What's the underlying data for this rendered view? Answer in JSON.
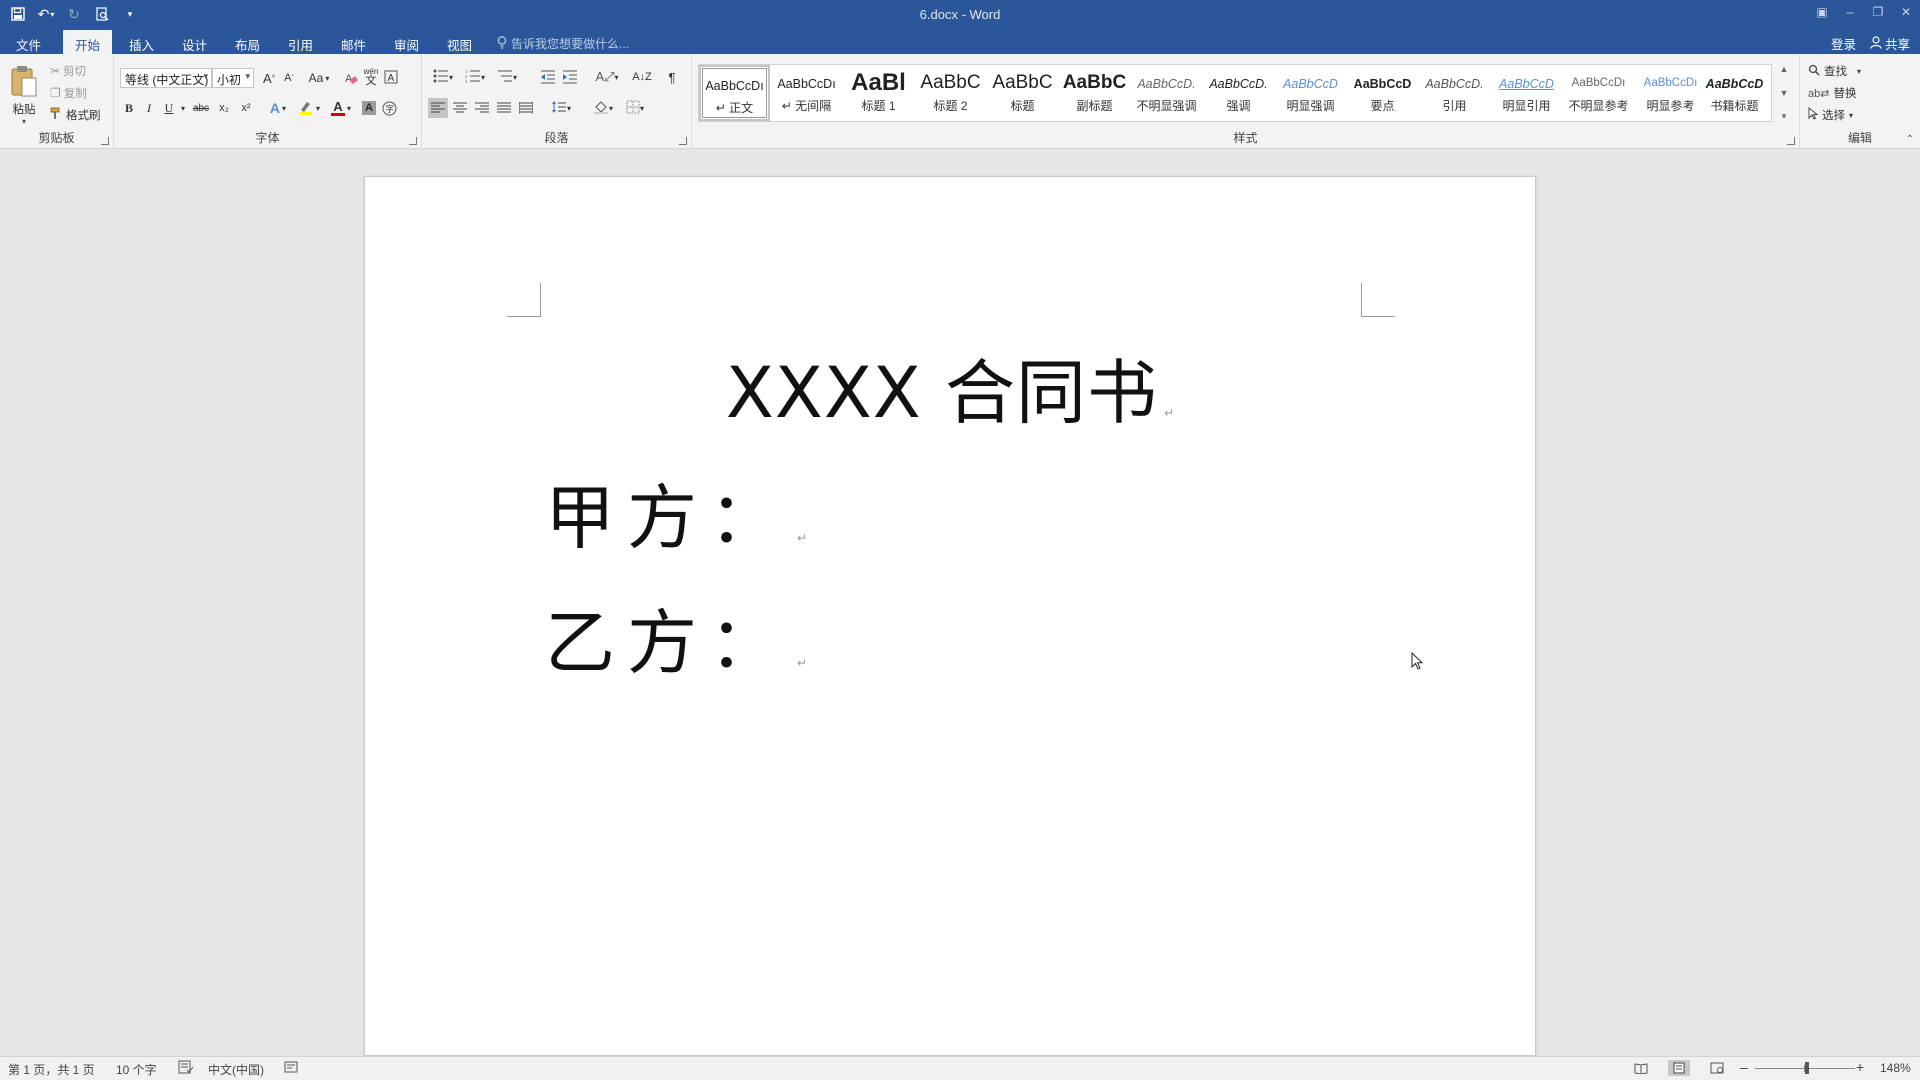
{
  "window": {
    "title": "6.docx - Word",
    "controls": [
      "▣",
      "–",
      "❐",
      "✕"
    ]
  },
  "quick_access": {
    "save_icon": "save-icon",
    "undo_icon": "undo-icon",
    "redo_icon": "redo-icon",
    "print_preview_icon": "print-preview-icon",
    "customize_icon": "customize-icon"
  },
  "tabs": [
    {
      "label": "文件"
    },
    {
      "label": "开始"
    },
    {
      "label": "插入"
    },
    {
      "label": "设计"
    },
    {
      "label": "布局"
    },
    {
      "label": "引用"
    },
    {
      "label": "邮件"
    },
    {
      "label": "审阅"
    },
    {
      "label": "视图"
    }
  ],
  "tell_me": {
    "placeholder": "告诉我您想要做什么..."
  },
  "account": {
    "signin": "登录",
    "share": "共享"
  },
  "clipboard": {
    "paste": "粘贴",
    "cut": "剪切",
    "copy": "复制",
    "format_painter": "格式刷",
    "group_label": "剪贴板"
  },
  "font": {
    "name": "等线 (中文正文)",
    "size": "小初",
    "group_label": "字体",
    "change_case": "Aa",
    "bold": "B",
    "italic": "I",
    "underline": "U",
    "strikethrough": "abc",
    "subscript": "x₂",
    "superscript": "x²",
    "phonetic": "wén"
  },
  "paragraph": {
    "group_label": "段落"
  },
  "styles": {
    "group_label": "样式",
    "items": [
      {
        "preview": "AaBbCcDı",
        "name": "↵ 正文"
      },
      {
        "preview": "AaBbCcDı",
        "name": "↵ 无间隔"
      },
      {
        "preview": "AaBl",
        "name": "标题 1"
      },
      {
        "preview": "AaBbC",
        "name": "标题 2"
      },
      {
        "preview": "AaBbC",
        "name": "标题"
      },
      {
        "preview": "AaBbC",
        "name": "副标题"
      },
      {
        "preview": "AaBbCcD.",
        "name": "不明显强调"
      },
      {
        "preview": "AaBbCcD.",
        "name": "强调"
      },
      {
        "preview": "AaBbCcD",
        "name": "明显强调"
      },
      {
        "preview": "AaBbCcD",
        "name": "要点"
      },
      {
        "preview": "AaBbCcD.",
        "name": "引用"
      },
      {
        "preview": "AaBbCcD",
        "name": "明显引用"
      },
      {
        "preview": "AaBbCcDı",
        "name": "不明显参考"
      },
      {
        "preview": "AaBbCcDı",
        "name": "明显参考"
      },
      {
        "preview": "AaBbCcD",
        "name": "书籍标题"
      }
    ]
  },
  "editing": {
    "find": "查找",
    "replace": "替换",
    "select": "选择",
    "group_label": "编辑"
  },
  "document": {
    "title": "XXXX 合同书",
    "party_a": "甲方：",
    "party_b": "乙方：",
    "pilcrow": "↵"
  },
  "status": {
    "page": "第 1 页，共 1 页",
    "words": "10 个字",
    "language": "中文(中国)",
    "zoom": "148%",
    "zoom_minus": "–",
    "zoom_plus": "+"
  },
  "colors": {
    "title_bar": "#2b579a",
    "ribbon": "#f3f3f3",
    "font_color": "#d0021b",
    "highlight": "#ffff00"
  }
}
